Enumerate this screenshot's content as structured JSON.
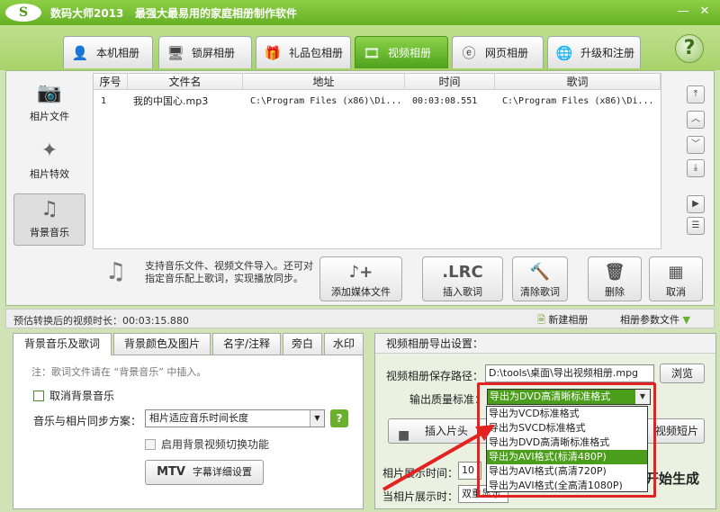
{
  "titlebar": {
    "logo": "S",
    "app_name": "数码大师2013",
    "slogan": "最强大最易用的家庭相册制作软件",
    "minimize": "—",
    "close": "✕"
  },
  "top_tabs": [
    {
      "label": "本机相册",
      "icon": "person-icon"
    },
    {
      "label": "锁屏相册",
      "icon": "monitor-icon"
    },
    {
      "label": "礼品包相册",
      "icon": "gift-icon"
    },
    {
      "label": "视频相册",
      "icon": "film-icon"
    },
    {
      "label": "网页相册",
      "icon": "browser-icon"
    },
    {
      "label": "升级和注册",
      "icon": "globe-icon"
    }
  ],
  "help": "?",
  "sidebar": [
    {
      "label": "相片文件",
      "icon": "camera-icon"
    },
    {
      "label": "相片特效",
      "icon": "sparkle-icon"
    },
    {
      "label": "背景音乐",
      "icon": "music-note-icon"
    }
  ],
  "table": {
    "headers": [
      "序号",
      "文件名",
      "地址",
      "时间",
      "歌词"
    ],
    "rows": [
      [
        "1",
        "我的中国心.mp3",
        "C:\\Program Files (x86)\\Di...",
        "00:03:08.551",
        "C:\\Program Files (x86)\\Di..."
      ]
    ]
  },
  "scroll_buttons": [
    "⤒",
    "︿",
    "﹀",
    "⤓",
    "▶",
    "☰"
  ],
  "hint": "支持音乐文件、视频文件导入。还可对指定音乐配上歌词，实现播放同步。",
  "actions": [
    {
      "label": "添加媒体文件",
      "glyph": "♪+"
    },
    {
      "label": "插入歌词",
      "glyph": ".LRC"
    },
    {
      "label": "清除歌词",
      "glyph": "🔨"
    },
    {
      "label": "删除",
      "glyph": "🗑"
    },
    {
      "label": "取消",
      "glyph": "▦"
    }
  ],
  "status": {
    "duration_text": "预估转换后的视频时长：00:03:15.880",
    "new_album": "新建相册",
    "param_file": "相册参数文件"
  },
  "sub_tabs": [
    "背景音乐及歌词",
    "背景颜色及图片",
    "名字/注释",
    "旁白",
    "水印"
  ],
  "music_panel": {
    "note": "注：歌词文件请在 “背景音乐” 中插入。",
    "cancel_bg_music": "取消背景音乐",
    "sync_label": "音乐与相片同步方案：",
    "sync_value": "相片适应音乐时间长度",
    "bg_video_switch": "启用背景视频切换功能",
    "mtv_badge": "MTV",
    "mtv_label": "字幕详细设置"
  },
  "export_panel": {
    "title": "视频相册导出设置：",
    "path_label": "视频相册保存路径：",
    "path_value": "D:\\tools\\桌面\\导出视频相册.mpg",
    "browse": "浏览",
    "quality_label": "输出质量标准：",
    "quality_value": "导出为DVD高清晰标准格式",
    "insert_label": "插入片头",
    "short_label": "视频短片",
    "show_time_label": "相片展示时间：",
    "show_time_value": "10",
    "when_label": "当相片展示时：",
    "when_value": "双重显示",
    "generate": "开始生成"
  },
  "quality_options": [
    "导出为VCD标准格式",
    "导出为SVCD标准格式",
    "导出为DVD高清晰标准格式",
    "导出为AVI格式(标清480P)",
    "导出为AVI格式(高清720P)",
    "导出为AVI格式(全高清1080P)"
  ],
  "selected_option_index": 3,
  "colors": {
    "titlebar": "#64b023",
    "active_tab": "#4fa11c",
    "selection": "#4a9e1a",
    "highlight": "#e52222"
  }
}
